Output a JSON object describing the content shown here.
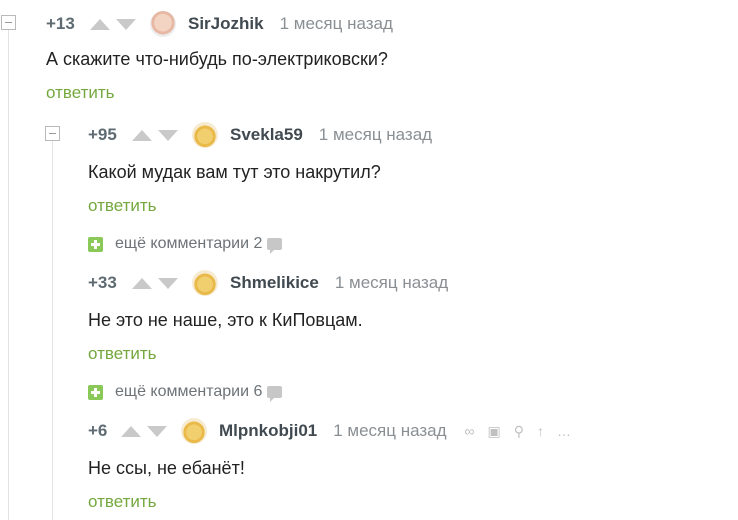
{
  "comments": [
    {
      "rating": "+13",
      "username": "SirJozhik",
      "time": "1 месяц назад",
      "text": "А скажите что-нибудь по-электриковски?",
      "reply": "ответить"
    },
    {
      "rating": "+95",
      "username": "Svekla59",
      "time": "1 месяц назад",
      "text": "Какой мудак вам тут это накрутил?",
      "reply": "ответить"
    },
    {
      "rating": "+33",
      "username": "Shmelikice",
      "time": "1 месяц назад",
      "text": "Не это не наше, это к КиПовцам.",
      "reply": "ответить"
    },
    {
      "rating": "+6",
      "username": "Mlpnkobji01",
      "time": "1 месяц назад",
      "text": "Не ссы, не ебанёт!",
      "reply": "ответить"
    }
  ],
  "more_comments": [
    {
      "label": "ещё комментарии 2"
    },
    {
      "label": "ещё комментарии 6"
    }
  ],
  "icons": {
    "collapse": "minus-square-icon",
    "expand": "plus-square-icon",
    "upvote": "triangle-up-icon",
    "downvote": "triangle-down-icon",
    "comment": "speech-bubble-icon",
    "link": "link-icon",
    "save": "floppy-disk-icon",
    "share": "share-icon",
    "scroll_up": "arrow-up-icon"
  },
  "colors": {
    "reply_link": "#74a83f",
    "expand_button": "#8ac858",
    "vote_arrow": "#c9c9c9"
  }
}
